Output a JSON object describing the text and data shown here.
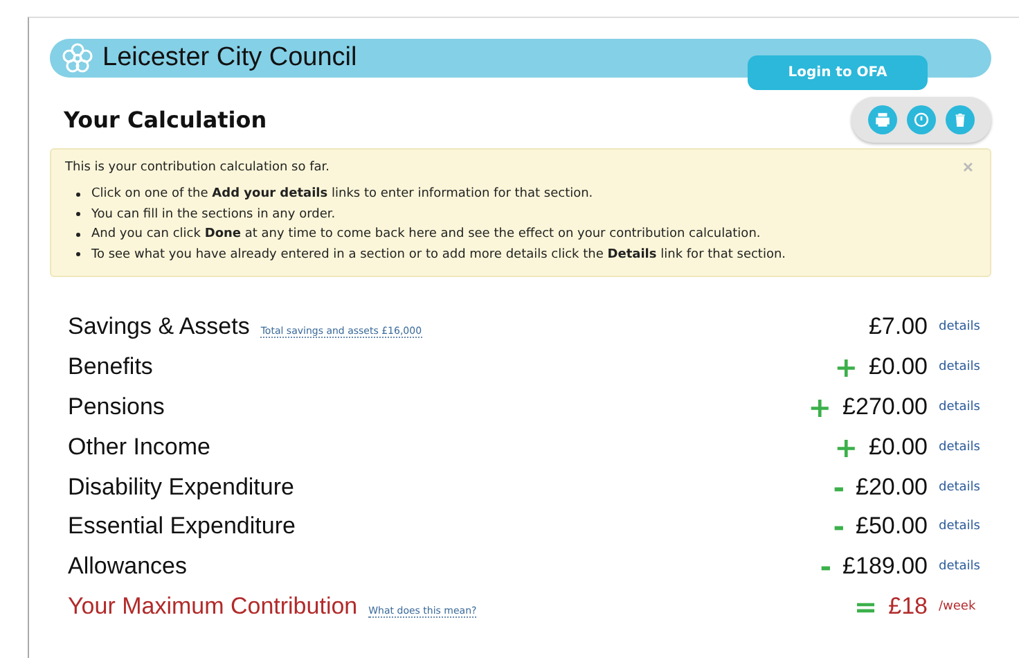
{
  "header": {
    "logo_text": "Leicester City Council",
    "login_button": "Login to OFA"
  },
  "title": "Your Calculation",
  "notice": {
    "intro": "This is your contribution calculation so far.",
    "close": "×",
    "bullets": [
      "Click on one of the **Add your details** links to enter information for that section.",
      "You can fill in the sections in any order.",
      "And you can click **Done** at any time to come back here and see the effect on your contribution calculation.",
      "To see what you have already entered in a section or to add more details click the **Details** link for that section."
    ]
  },
  "rows": [
    {
      "kind": "item",
      "label": "Savings & Assets",
      "note": "Total savings and assets £16,000",
      "amount": "£7.00",
      "link": "details"
    },
    {
      "kind": "item",
      "label": "Benefits",
      "sign": "+",
      "amount": "£0.00",
      "link": "details"
    },
    {
      "kind": "item",
      "label": "Pensions",
      "sign": "+",
      "amount": "£270.00",
      "link": "details"
    },
    {
      "kind": "item",
      "label": "Other Income",
      "sign": "+",
      "amount": "£0.00",
      "link": "details"
    },
    {
      "kind": "item",
      "label": "Disability Expenditure",
      "sign": "-",
      "amount": "£20.00",
      "link": "details"
    },
    {
      "kind": "item",
      "label": "Essential Expenditure",
      "sign": "-",
      "amount": "£50.00",
      "link": "details"
    },
    {
      "kind": "item",
      "label": "Allowances",
      "sign": "-",
      "amount": "£189.00",
      "link": "details"
    },
    {
      "kind": "total",
      "label": "Your Maximum Contribution",
      "note": "What does this mean?",
      "sign": "=",
      "amount": "£18",
      "link": "/week"
    }
  ]
}
